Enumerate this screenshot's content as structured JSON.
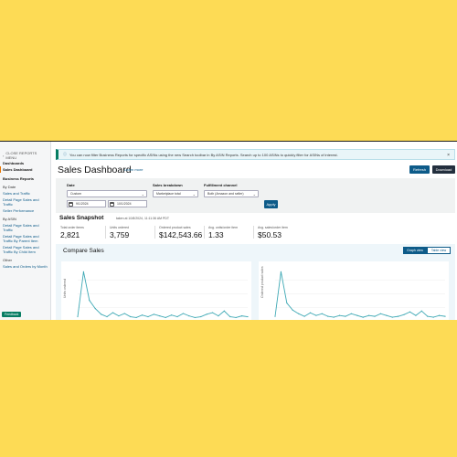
{
  "sidebar": {
    "close_menu": "CLOSE REPORTS MENU",
    "dashboards": "Dashboards",
    "sales_dashboard": "Sales Dashboard",
    "business_reports": "Business Reports",
    "by_date": "By Date",
    "by_date_items": [
      "Sales and Traffic",
      "Detail Page Sales and Traffic",
      "Seller Performance"
    ],
    "by_asin": "By ASIN",
    "by_asin_items": [
      "Detail Page Sales and Traffic",
      "Detail Page Sales and Traffic By Parent Item",
      "Detail Page Sales and Traffic By Child Item"
    ],
    "other": "Other",
    "other_items": [
      "Sales and Orders by Month"
    ],
    "badge": "Feedback"
  },
  "banner": {
    "text": "You can now filter Business Reports for specific ASINs using the new Search toolbar in By ASIN Reports. Search up to 100 ASINs to quickly filter for ASINs of interest.",
    "close": "×"
  },
  "header": {
    "title": "Sales Dashboard",
    "learn_more": "Learn more",
    "refresh": "Refresh",
    "download": "Download"
  },
  "filters": {
    "date_label": "Date",
    "date_value": "Custom",
    "start_date": "9/1/2024",
    "end_date": "10/1/2024",
    "breakdown_label": "Sales breakdown",
    "breakdown_value": "Marketplace total",
    "channel_label": "Fulfillment channel",
    "channel_value": "Both (Amazon and seller)",
    "apply": "Apply"
  },
  "snapshot": {
    "title": "Sales Snapshot",
    "taken": "taken at 10/8/2024, 11:11:36 AM PDT",
    "metrics": [
      {
        "label": "Total order items",
        "value": "2,821"
      },
      {
        "label": "Units ordered",
        "value": "3,759"
      },
      {
        "label": "Ordered product sales",
        "value": "$142,543.66"
      },
      {
        "label": "Avg. units/order item",
        "value": "1.33"
      },
      {
        "label": "Avg. sales/order item",
        "value": "$50.53"
      }
    ]
  },
  "compare": {
    "title": "Compare Sales",
    "graph_view": "Graph view",
    "table_view": "Table view",
    "left_ylabel": "Units ordered",
    "right_ylabel": "Ordered product sales",
    "line_color": "#3fa9b5"
  },
  "chart_data": [
    {
      "type": "line",
      "ylabel": "Units ordered",
      "series": [
        {
          "values": [
            5,
            60,
            25,
            15,
            8,
            5,
            10,
            6,
            9,
            5,
            4,
            7,
            5,
            8,
            6,
            4,
            7,
            5,
            9,
            6,
            4,
            5,
            8,
            10,
            6,
            12,
            5,
            4,
            6,
            5
          ]
        }
      ]
    },
    {
      "type": "line",
      "ylabel": "Ordered product sales",
      "series": [
        {
          "values": [
            5,
            55,
            20,
            12,
            8,
            5,
            9,
            6,
            8,
            5,
            4,
            6,
            5,
            8,
            6,
            4,
            6,
            5,
            8,
            6,
            4,
            5,
            7,
            10,
            6,
            11,
            5,
            4,
            6,
            5
          ]
        }
      ]
    }
  ]
}
